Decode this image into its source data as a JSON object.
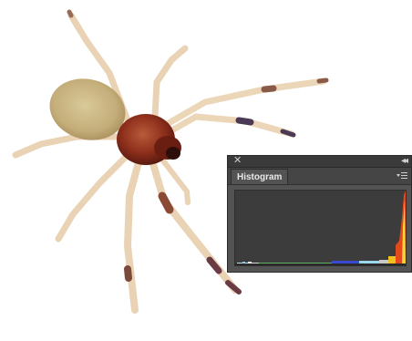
{
  "photo": {
    "subject_icon": "spider-icon",
    "background_color": "#ffffff"
  },
  "panel": {
    "close_glyph": "✕",
    "collapse_glyph": "◂◂",
    "tab_label": "Histogram",
    "menu_icon": "panel-menu-icon",
    "colors": {
      "panel_bg": "#535353",
      "graph_bg": "#3c3c3c",
      "titlebar_bg": "#3a3a3a"
    }
  }
}
